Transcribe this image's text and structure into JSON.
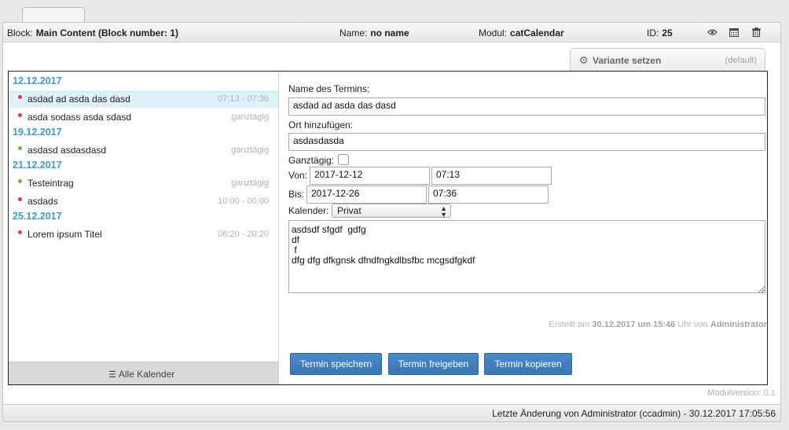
{
  "header": {
    "block_label": "Block:",
    "block_value": "Main Content (Block number: 1)",
    "name_label": "Name:",
    "name_value": "no name",
    "modul_label": "Modul:",
    "modul_value": "catCalendar",
    "id_label": "ID:",
    "id_value": "25",
    "icons": [
      "eye-icon",
      "calendar-icon",
      "trash-icon"
    ]
  },
  "variant": {
    "label": "Variante setzen",
    "default": "(default)",
    "icon": "gear-icon"
  },
  "calendar_list": {
    "groups": [
      {
        "date": "12.12.2017",
        "entries": [
          {
            "title": "asdad ad asda das dasd",
            "time": "07:13 - 07:36",
            "color": "#e0306a",
            "selected": true
          },
          {
            "title": "asda sodass asda sdasd",
            "time": "ganztägig",
            "color": "#e0306a",
            "selected": false
          }
        ]
      },
      {
        "date": "19.12.2017",
        "entries": [
          {
            "title": "asdasd asdasdasd",
            "time": "ganztägig",
            "color": "#6cb33f",
            "selected": false
          }
        ]
      },
      {
        "date": "21.12.2017",
        "entries": [
          {
            "title": "Testeintrag",
            "time": "ganztägig",
            "color": "#6cb33f",
            "selected": false
          },
          {
            "title": "asdads",
            "time": "10:00 - 00:00",
            "color": "#e0306a",
            "selected": false
          }
        ]
      },
      {
        "date": "25.12.2017",
        "entries": [
          {
            "title": "Lorem ipsum Titel",
            "time": "06:20 - 20:20",
            "color": "#e0306a",
            "selected": false
          }
        ]
      }
    ],
    "all_calendars_label": "Alle Kalender"
  },
  "form": {
    "name_label": "Name des Termins:",
    "name_value": "asdad ad asda das dasd",
    "location_label": "Ort hinzufügen:",
    "location_value": "asdasdasda",
    "allday_label": "Ganztägig:",
    "from_label": "Von:",
    "from_date": "2017-12-12",
    "from_time": "07:13",
    "to_label": "Bis:",
    "to_date": "2017-12-26",
    "to_time": "07:36",
    "calendar_label": "Kalender:",
    "calendar_value": "Privat",
    "description": "asdsdf sfgdf  gdfg\ndf\n f\ndfg dfg dfkgnsk dfndfngkdlbsfbc mcgsdfgkdf",
    "created_prefix": "Erstellt am",
    "created_datetime": "30.12.2017 um 15:46",
    "created_mid": "Uhr von",
    "created_by": "Administrator"
  },
  "buttons": {
    "save": "Termin speichern",
    "release": "Termin freigeben",
    "copy": "Termin kopieren"
  },
  "modulversion": "Modulversion: 0.1",
  "footer": "Letzte Änderung von Administrator (ccadmin) - 30.12.2017 17:05:56"
}
